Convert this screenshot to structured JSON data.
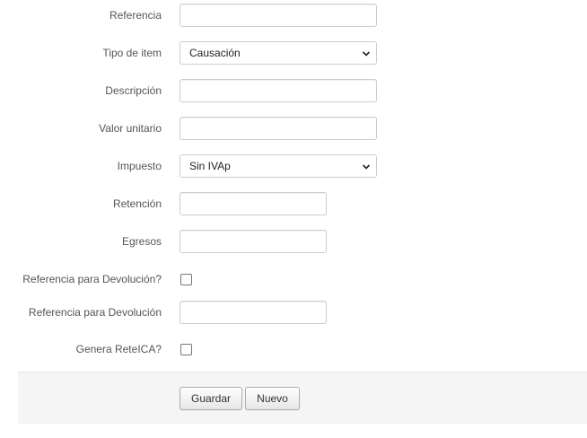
{
  "form": {
    "referencia": {
      "label": "Referencia",
      "value": ""
    },
    "tipo_item": {
      "label": "Tipo de item",
      "selected": "Causación"
    },
    "descripcion": {
      "label": "Descripción",
      "value": ""
    },
    "valor_unitario": {
      "label": "Valor unitario",
      "value": ""
    },
    "impuesto": {
      "label": "Impuesto",
      "selected": "Sin IVAp"
    },
    "retencion": {
      "label": "Retención",
      "value": ""
    },
    "egresos": {
      "label": "Egresos",
      "value": ""
    },
    "ref_devolucion_check": {
      "label": "Referencia para Devolución?",
      "checked": false
    },
    "ref_devolucion": {
      "label": "Referencia para Devolución",
      "value": ""
    },
    "genera_reteica": {
      "label": "Genera ReteICA?",
      "checked": false
    }
  },
  "actions": {
    "guardar_label": "Guardar",
    "nuevo_label": "Nuevo"
  },
  "icons": {
    "select_arrow": "chevron-down-icon"
  }
}
